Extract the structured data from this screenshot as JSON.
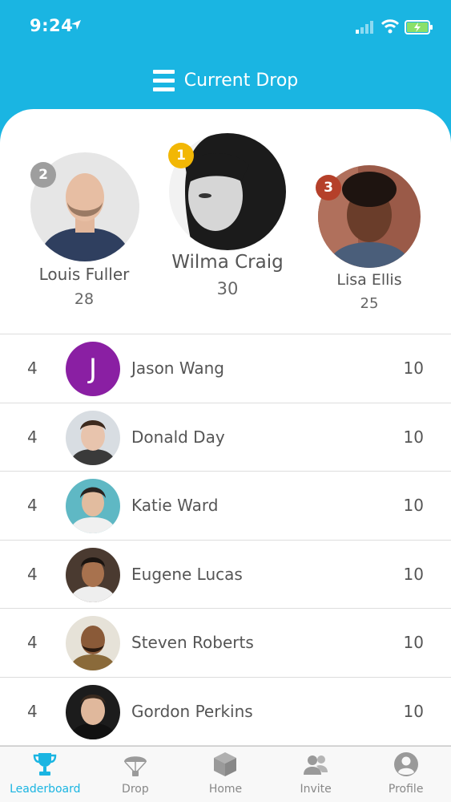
{
  "status_bar": {
    "time": "9:24"
  },
  "header": {
    "title": "Current Drop"
  },
  "podium": [
    {
      "rank": "2",
      "name": "Louis Fuller",
      "score": "28",
      "badge_color": "#9e9e9e"
    },
    {
      "rank": "1",
      "name": "Wilma Craig",
      "score": "30",
      "badge_color": "#f2b705"
    },
    {
      "rank": "3",
      "name": "Lisa Ellis",
      "score": "25",
      "badge_color": "#b5402a"
    }
  ],
  "leaderboard": [
    {
      "rank": "4",
      "name": "Jason Wang",
      "score": "10",
      "initial": "J"
    },
    {
      "rank": "4",
      "name": "Donald Day",
      "score": "10"
    },
    {
      "rank": "4",
      "name": "Katie Ward",
      "score": "10"
    },
    {
      "rank": "4",
      "name": "Eugene Lucas",
      "score": "10"
    },
    {
      "rank": "4",
      "name": "Steven Roberts",
      "score": "10"
    },
    {
      "rank": "4",
      "name": "Gordon Perkins",
      "score": "10"
    }
  ],
  "tabs": [
    {
      "label": "Leaderboard",
      "icon": "trophy-icon",
      "active": true
    },
    {
      "label": "Drop",
      "icon": "parachute-icon"
    },
    {
      "label": "Home",
      "icon": "box-icon"
    },
    {
      "label": "Invite",
      "icon": "people-icon"
    },
    {
      "label": "Profile",
      "icon": "user-icon"
    }
  ],
  "colors": {
    "accent": "#1ab5e2",
    "initial_avatar": "#8a1fa3"
  }
}
